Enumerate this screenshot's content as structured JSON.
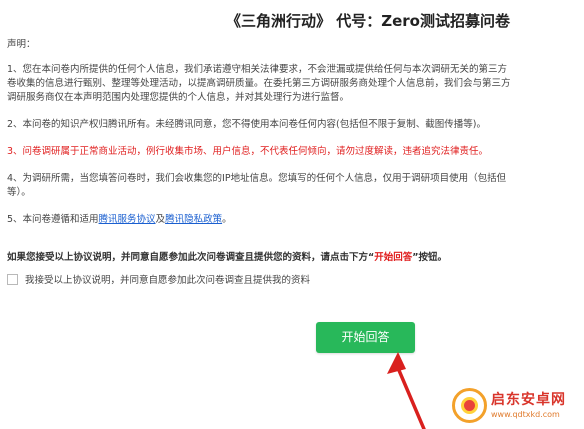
{
  "header": {
    "title": "《三角洲行动》 代号：Zero测试招募问卷"
  },
  "statement": {
    "heading": "声明：",
    "p1": [
      "1、您在本问卷内所提供的任何个人信息，我们承诺遵守相关法律要求，不会泄漏或提供给任何与本次调研无关的第三方",
      "卷收集的信息进行甄别、整理等处理活动，以提高调研质量。在委托第三方调研服务商处理个人信息前，我们会与第三方",
      "调研服务商仅在本声明范围内处理您提供的个人信息，并对其处理行为进行监督。"
    ],
    "p2": "2、本问卷的知识产权归腾讯所有。未经腾讯同意，您不得使用本问卷任何内容(包括但不限于复制、截图传播等)。",
    "p3": "3、问卷调研属于正常商业活动，例行收集市场、用户信息，不代表任何倾向，请勿过度解读，违者追究法律责任。",
    "p4": [
      "4、为调研所需，当您填答问卷时，我们会收集您的IP地址信息。您填写的任何个人信息，仅用于调研项目使用（包括但",
      "等）。"
    ],
    "p5_prefix": "5、本问卷遵循和适用",
    "p5_link1": "腾讯服务协议",
    "p5_mid": "及",
    "p5_link2": "腾讯隐私政策",
    "p5_suffix": "。"
  },
  "agree_note": {
    "prefix": "如果您接受以上协议说明，并同意自愿参加此次问卷调查且提供您的资料，请点击下方“",
    "highlight": "开始回答",
    "suffix": "”按钮。"
  },
  "consent_checkbox": {
    "label": "我接受以上协议说明，并同意自愿参加此次问卷调查且提供我的资料",
    "checked": false
  },
  "start_button": {
    "label": "开始回答",
    "color": "#28b85a"
  },
  "annotation": {
    "arrow_color": "#d9201e"
  },
  "watermark": {
    "name": "启东安卓网",
    "url": "www.qdtxkd.com",
    "icon": "qidong-logo-icon"
  },
  "colors": {
    "warning_text": "#e02020",
    "link": "#1a5fd0"
  }
}
